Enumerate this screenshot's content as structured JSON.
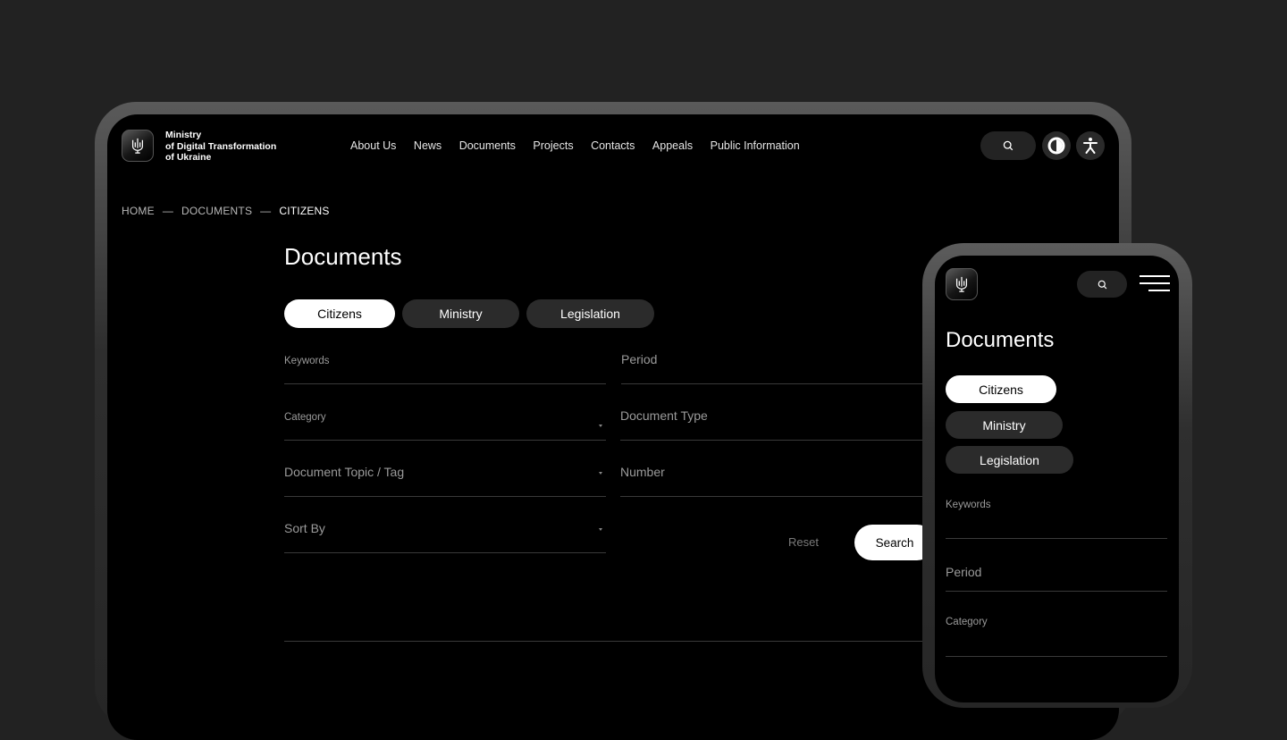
{
  "desktop": {
    "brand": {
      "line1": "Ministry",
      "line2": "of Digital Transformation",
      "line3": "of Ukraine"
    },
    "nav": [
      "About Us",
      "News",
      "Documents",
      "Projects",
      "Contacts",
      "Appeals",
      "Public Information"
    ],
    "breadcrumb": {
      "home": "HOME",
      "sep": "—",
      "documents": "DOCUMENTS",
      "citizens": "CITIZENS"
    },
    "title": "Documents",
    "tabs": [
      "Citizens",
      "Ministry",
      "Legislation"
    ],
    "active_tab": "Citizens",
    "filters": {
      "keywords": "Keywords",
      "period": "Period",
      "category": "Category",
      "document_type": "Document Type",
      "topic": "Document Topic / Tag",
      "number": "Number",
      "sort_by": "Sort By"
    },
    "reset_label": "Reset",
    "search_label": "Search"
  },
  "mobile": {
    "title": "Documents",
    "tabs": [
      "Citizens",
      "Ministry",
      "Legislation"
    ],
    "active_tab": "Citizens",
    "filters": {
      "keywords": "Keywords",
      "period": "Period",
      "category": "Category"
    }
  },
  "icons": [
    "trident-logo-icon",
    "search-icon",
    "contrast-icon",
    "accessibility-icon",
    "menu-icon",
    "chevron-down-icon"
  ],
  "colors": {
    "background": "#222222",
    "screen": "#000000",
    "pill": "#2b2b2b",
    "active_pill": "#ffffff"
  }
}
